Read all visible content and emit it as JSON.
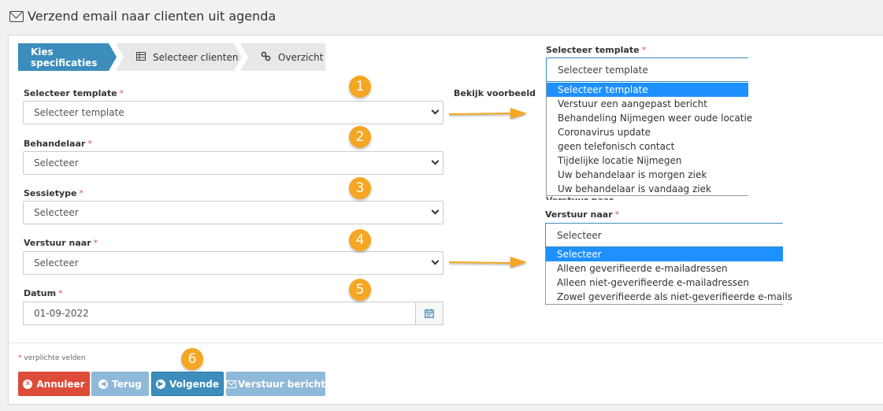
{
  "page": {
    "title": "Verzend email naar clienten uit agenda"
  },
  "wizard": {
    "steps": [
      {
        "label": "Kies specificaties",
        "active": true
      },
      {
        "label": "Selecteer clienten",
        "icon": "table-icon"
      },
      {
        "label": "Overzicht",
        "icon": "link-icon"
      }
    ]
  },
  "form": {
    "required_mark": "*",
    "template": {
      "label": "Selecteer template",
      "value": "Selecteer template"
    },
    "behandelaar": {
      "label": "Behandelaar",
      "value": "Selecteer"
    },
    "sessietype": {
      "label": "Sessietype",
      "value": "Selecteer"
    },
    "verstuur_naar": {
      "label": "Verstuur naar",
      "value": "Selecteer"
    },
    "datum": {
      "label": "Datum",
      "value": "01-09-2022"
    },
    "preview_link": "Bekijk voorbeeld"
  },
  "callouts": [
    "1",
    "2",
    "3",
    "4",
    "5",
    "6"
  ],
  "template_dropdown": {
    "label": "Selecteer template",
    "selected": "Selecteer template",
    "options": [
      "Selecteer template",
      "Verstuur een aangepast bericht",
      "Behandeling Nijmegen weer oude locatie",
      "Coronavirus update",
      "geen telefonisch contact",
      "Tijdelijke locatie Nijmegen",
      "Uw behandelaar is morgen ziek",
      "Uw behandelaar is vandaag ziek"
    ],
    "highlighted_index": 0
  },
  "recipient_dropdown": {
    "label": "Verstuur naar",
    "selected": "Selecteer",
    "options": [
      "Selecteer",
      "Alleen geverifieerde e-mailadressen",
      "Alleen niet-geverifieerde e-mailadressen",
      "Zowel geverifieerde als niet-geverifieerde e-mails"
    ],
    "highlighted_index": 0
  },
  "footer": {
    "required_note": "verplichte velden",
    "buttons": {
      "cancel": "Annuleer",
      "back": "Terug",
      "next": "Volgende",
      "send": "Verstuur bericht"
    }
  },
  "colors": {
    "primary": "#3c8dbc",
    "danger": "#dd4b39",
    "callout": "#f5a623",
    "highlight": "#1e90ff"
  }
}
